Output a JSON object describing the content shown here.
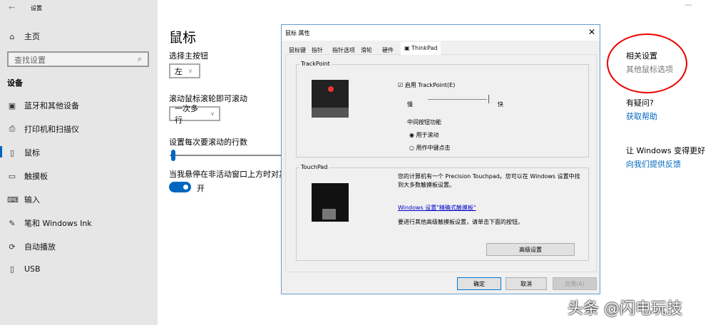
{
  "settings": {
    "title": "设置",
    "home": "主页",
    "search_placeholder": "查找设置",
    "section": "设备",
    "nav": [
      "蓝牙和其他设备",
      "打印机和扫描仪",
      "鼠标",
      "触摸板",
      "输入",
      "笔和 Windows Ink",
      "自动播放",
      "USB"
    ]
  },
  "main": {
    "title": "鼠标",
    "primary_label": "选择主按钮",
    "primary_value": "左",
    "scroll_label": "滚动鼠标滚轮即可滚动",
    "scroll_value": "一次多行",
    "lines_label": "设置每次要滚动的行数",
    "lines_fraction": 0.03,
    "inactive_label": "当我悬停在非活动窗口上方时对其进行滚动",
    "toggle_value": "开"
  },
  "related": {
    "title": "相关设置",
    "link": "其他鼠标选项",
    "question": "有疑问?",
    "help": "获取帮助",
    "better": "让 Windows 变得更好",
    "feedback": "向我们提供反馈",
    "accent": "#0067c0"
  },
  "dialog": {
    "title": "鼠标 属性",
    "tabs": [
      "鼠标键",
      "指针",
      "指针选项",
      "滑轮",
      "硬件",
      "ThinkPad"
    ],
    "trackpoint": {
      "group": "TrackPoint",
      "enable": "启用 TrackPoint(E)",
      "slow": "慢",
      "fast": "快",
      "speed_fraction": 1.0,
      "middle": "中间按钮功能",
      "opt1": "用于滚动",
      "opt2": "用作中键点击"
    },
    "touchpad": {
      "group": "TouchPad",
      "desc": "您的计算机有一个 Precision Touchpad。您可以在 Windows 设置中找到大多数触摸板设置。",
      "link": "Windows 设置\"精确式触摸板\"",
      "hint": "要进行其他高级触摸板设置，请单击下面的按钮。",
      "advanced": "高级设置"
    },
    "ok": "确定",
    "cancel": "取消",
    "apply": "应用(A)"
  },
  "watermark": "头条 @闪电玩技"
}
